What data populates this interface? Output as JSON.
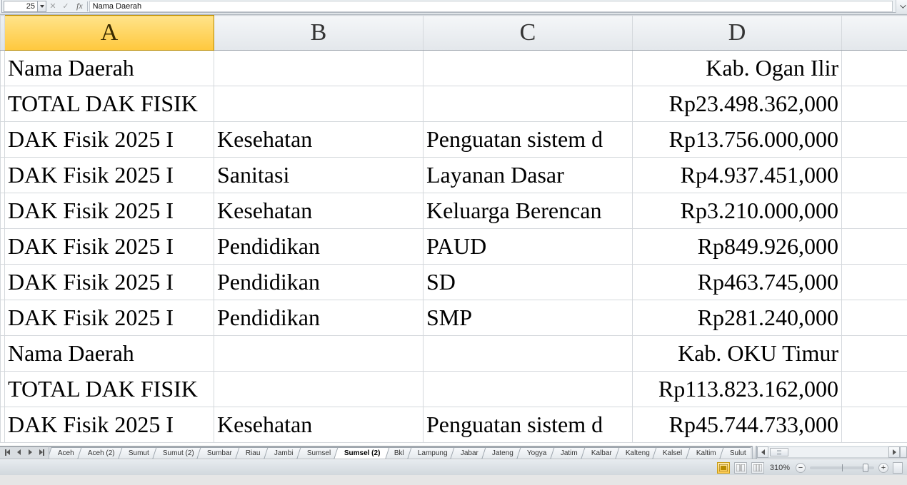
{
  "cellRef": "25",
  "formula": "Nama Daerah",
  "columns": [
    "A",
    "B",
    "C",
    "D"
  ],
  "selectedCol": 0,
  "rows": [
    {
      "a": "Nama Daerah",
      "b": "",
      "c": "",
      "d": "Kab. Ogan Ilir"
    },
    {
      "a": "TOTAL DAK FISIK",
      "b": "",
      "c": "",
      "d": "Rp23.498.362,000"
    },
    {
      "a": "DAK Fisik 2025 I",
      "b": "Kesehatan",
      "c": "Penguatan sistem d",
      "d": "Rp13.756.000,000"
    },
    {
      "a": "DAK Fisik 2025 I",
      "b": "Sanitasi",
      "c": "Layanan Dasar",
      "d": "Rp4.937.451,000"
    },
    {
      "a": "DAK Fisik 2025 I",
      "b": "Kesehatan",
      "c": "Keluarga Berencan",
      "d": "Rp3.210.000,000"
    },
    {
      "a": "DAK Fisik 2025 I",
      "b": "Pendidikan",
      "c": "PAUD",
      "d": "Rp849.926,000"
    },
    {
      "a": "DAK Fisik 2025 I",
      "b": "Pendidikan",
      "c": "SD",
      "d": "Rp463.745,000"
    },
    {
      "a": "DAK Fisik 2025 I",
      "b": "Pendidikan",
      "c": "SMP",
      "d": "Rp281.240,000"
    },
    {
      "a": "Nama Daerah",
      "b": "",
      "c": "",
      "d": "Kab. OKU Timur"
    },
    {
      "a": "TOTAL DAK FISIK",
      "b": "",
      "c": "",
      "d": "Rp113.823.162,000"
    },
    {
      "a": "DAK Fisik 2025 I",
      "b": "Kesehatan",
      "c": "Penguatan sistem d",
      "d": "Rp45.744.733,000"
    }
  ],
  "tabs": [
    "Aceh",
    "Aceh (2)",
    "Sumut",
    "Sumut (2)",
    "Sumbar",
    "Riau",
    "Jambi",
    "Sumsel",
    "Sumsel (2)",
    "Bkl",
    "Lampung",
    "Jabar",
    "Jateng",
    "Yogya",
    "Jatim",
    "Kalbar",
    "Kalteng",
    "Kalsel",
    "Kaltim",
    "Sulut"
  ],
  "activeTab": 8,
  "zoom": "310%",
  "zoomThumbPct": 82
}
